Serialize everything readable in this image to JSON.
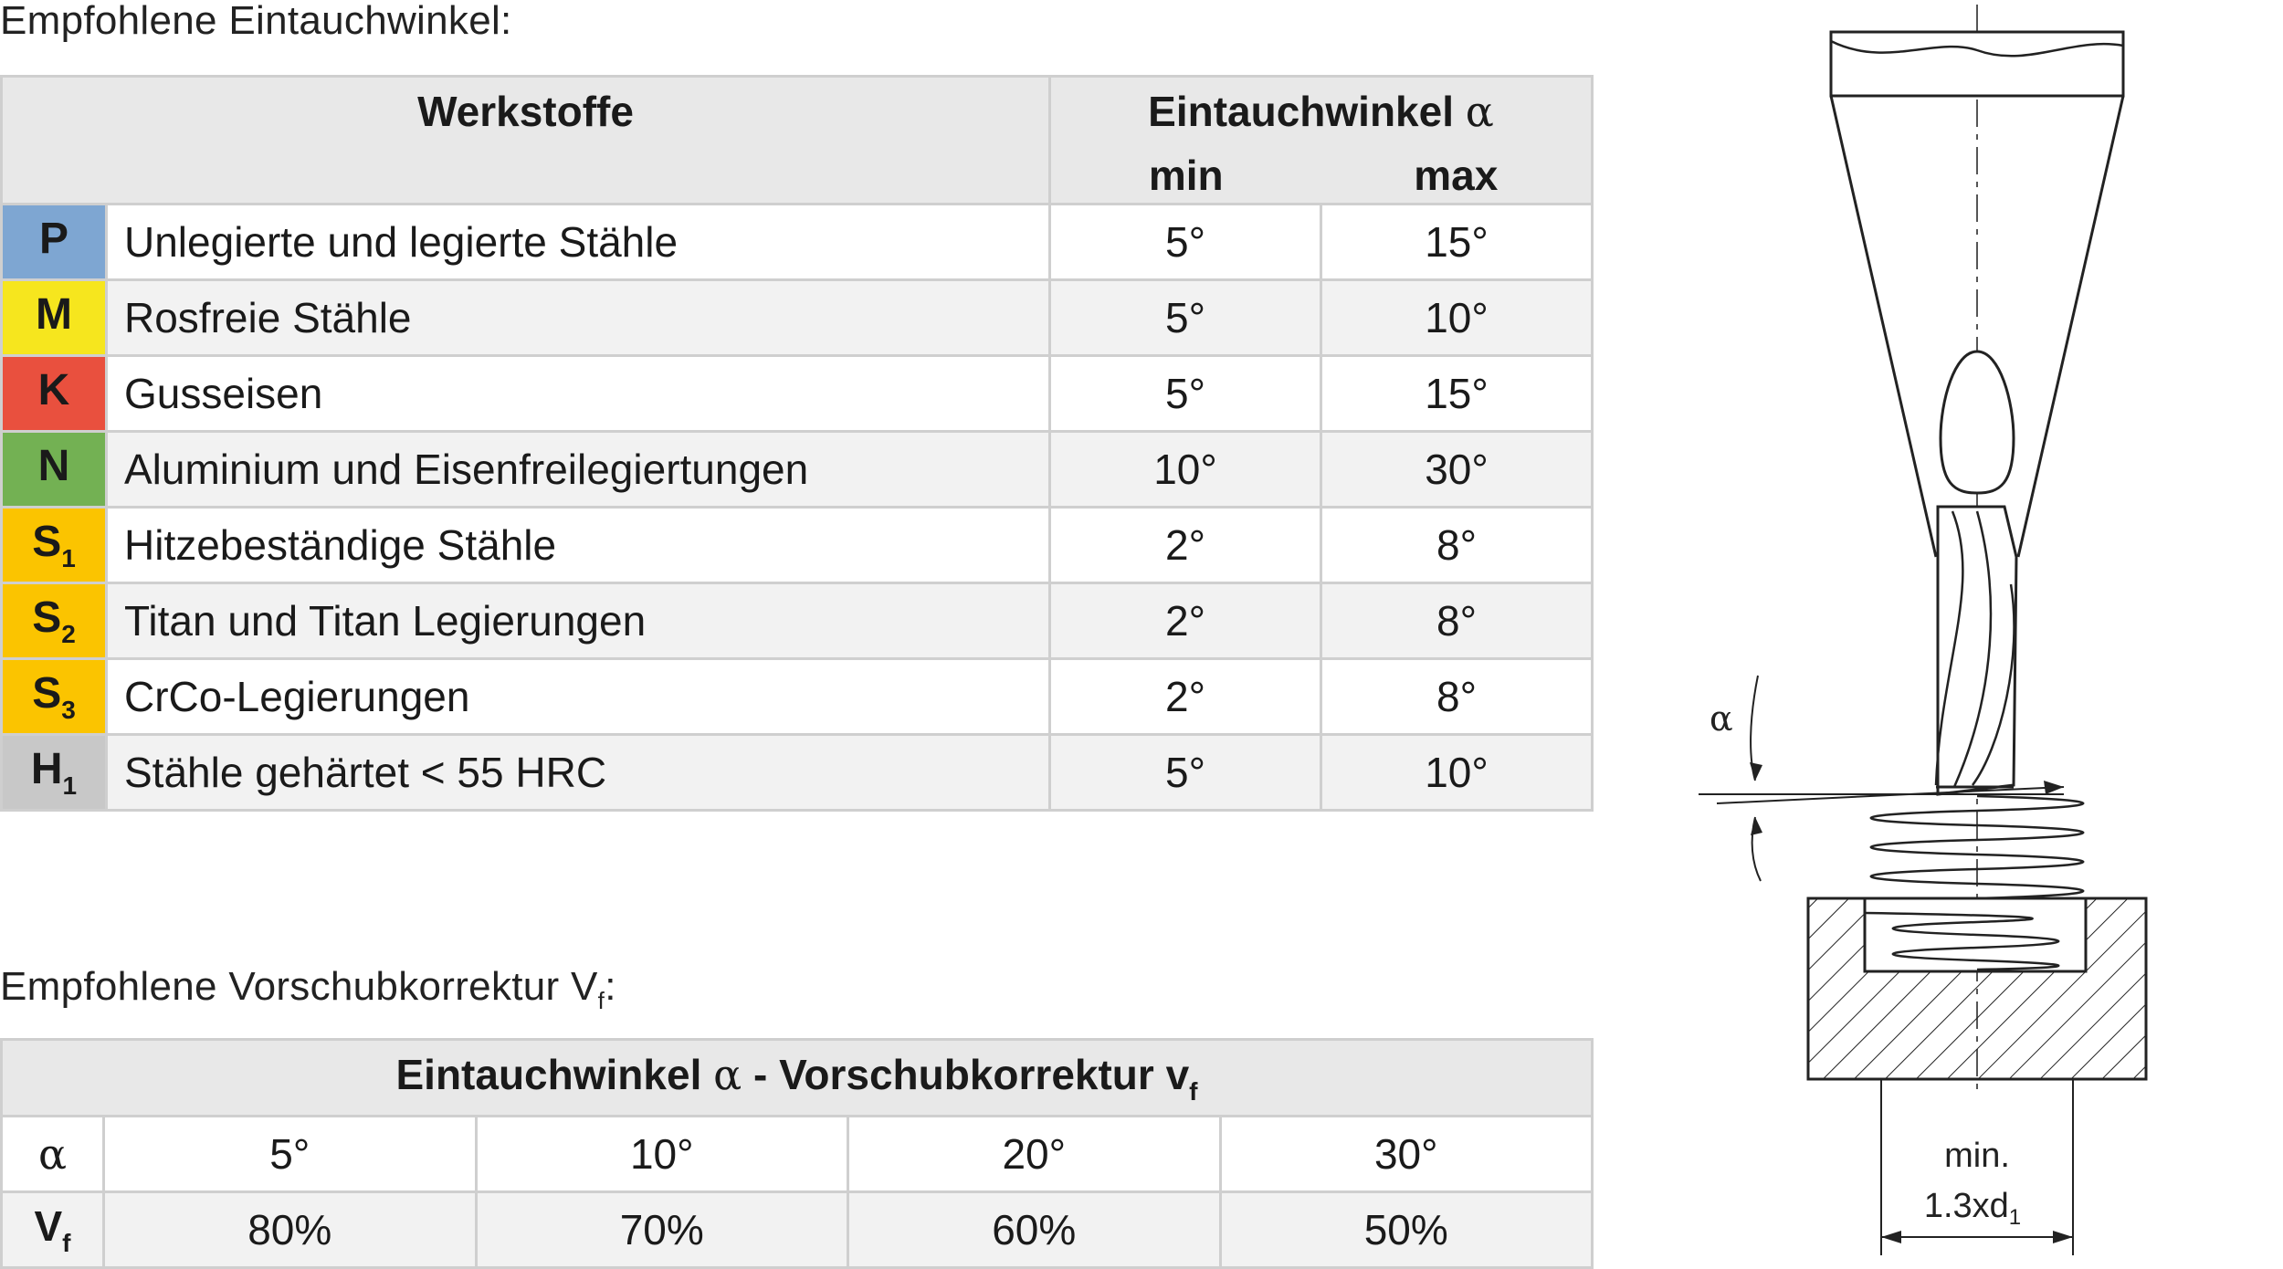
{
  "angles_heading": {
    "text": "Empfohlene Eintauchwinkel:"
  },
  "feed_heading": {
    "text": "Empfohlene Vorschubkorrektur V",
    "sub": "f",
    "suffix": ":"
  },
  "table1": {
    "col_material": "Werkstoffe",
    "col_angle": "Eintauchwinkel",
    "alpha": "α",
    "col_min": "min",
    "col_max": "max",
    "rows": [
      {
        "code": "P",
        "code_sub": "",
        "color": "#7ea6d2",
        "name": "Unlegierte und legierte Stähle",
        "min": "5°",
        "max": "15°"
      },
      {
        "code": "M",
        "code_sub": "",
        "color": "#f6e61e",
        "name": "Rosfreie Stähle",
        "min": "5°",
        "max": "10°"
      },
      {
        "code": "K",
        "code_sub": "",
        "color": "#e9503e",
        "name": "Gusseisen",
        "min": "5°",
        "max": "15°"
      },
      {
        "code": "N",
        "code_sub": "",
        "color": "#73b153",
        "name": "Aluminium und Eisenfreilegiertungen",
        "min": "10°",
        "max": "30°"
      },
      {
        "code": "S",
        "code_sub": "1",
        "color": "#fbc400",
        "name": "Hitzebeständige Stähle",
        "min": "2°",
        "max": "8°"
      },
      {
        "code": "S",
        "code_sub": "2",
        "color": "#fbc400",
        "name": "Titan und Titan Legierungen",
        "min": "2°",
        "max": "8°"
      },
      {
        "code": "S",
        "code_sub": "3",
        "color": "#fbc400",
        "name": "CrCo-Legierungen",
        "min": "2°",
        "max": "8°"
      },
      {
        "code": "H",
        "code_sub": "1",
        "color": "#c8c8c8",
        "name": "Stähle gehärtet < 55 HRC",
        "min": "5°",
        "max": "10°"
      }
    ]
  },
  "table2": {
    "title_prefix": "Eintauchwinkel",
    "alpha": "α",
    "title_suffix": "- Vorschubkorrektur v",
    "title_sub": "f",
    "row_alpha_label": "α",
    "row_vf_label": "V",
    "row_vf_sub": "f",
    "angles": [
      "5°",
      "10°",
      "20°",
      "30°"
    ],
    "feeds": [
      "80%",
      "70%",
      "60%",
      "50%"
    ]
  },
  "drawing": {
    "alpha_label": "α",
    "dim_line1": "min.",
    "dim_line2": "1.3xd",
    "dim_sub": "1"
  }
}
